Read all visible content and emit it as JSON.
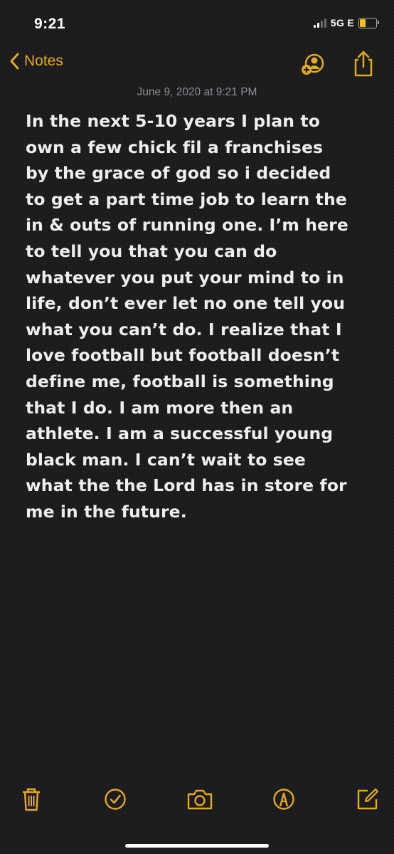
{
  "status_bar": {
    "time": "9:21",
    "network": "5G E",
    "battery_level": 0.35,
    "signal_bars": 2
  },
  "nav": {
    "back_label": "Notes",
    "back_icon": "chevron-left-icon",
    "icons": [
      "add-person-icon",
      "share-icon"
    ],
    "accent_color": "#e5a823"
  },
  "note": {
    "date": "June 9, 2020 at 9:21 PM",
    "lines": [
      "In the next 5-10 years I plan to",
      "own a few chick fil a franchises",
      "by the grace of god so i decided",
      "to get a part time job to learn the",
      "in & outs of running one. I’m here",
      "to tell you that you can do",
      "whatever you put your mind to in",
      "life, don’t ever let no one tell you",
      "what you can’t do. I realize that I",
      "love football but football doesn’t",
      "define me, football is something",
      "that I do. I am more then an",
      "athlete. I am a successful young",
      "black man. I can’t wait to see",
      "what the the Lord has in store for",
      "me in the future."
    ]
  },
  "toolbar": {
    "icons": [
      "trash-icon",
      "checklist-icon",
      "camera-icon",
      "markup-icon",
      "compose-icon"
    ]
  }
}
